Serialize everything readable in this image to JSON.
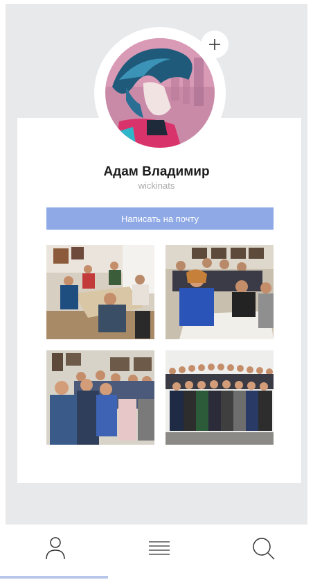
{
  "profile": {
    "name": "Адам Владимир",
    "username": "wickinats",
    "mail_button_label": "Написать на почту"
  },
  "icons": {
    "add": "plus-icon",
    "profile_tab": "user-icon",
    "menu_tab": "hamburger-menu-icon",
    "search_tab": "search-icon"
  },
  "colors": {
    "accent": "#8fa9e6",
    "tab_indicator": "#b8c6ea",
    "background": "#e8e9eb"
  },
  "tabs": {
    "active": "profile"
  }
}
